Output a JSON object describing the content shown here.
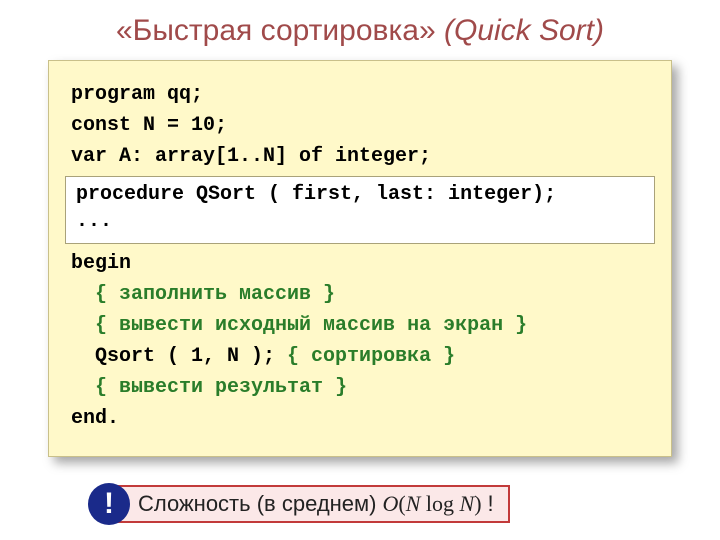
{
  "title": {
    "main": "«Быстрая сортировка»",
    "alt": " (Quick Sort)"
  },
  "code": {
    "l1": "program qq;",
    "l2": "const N = 10;",
    "l3": "var A: array[1..N] of integer;",
    "inset1": "procedure QSort ( first, last: integer);",
    "inset2": "...",
    "l4": "begin",
    "l5a": "  { ",
    "l5b": "заполнить массив",
    "l5c": " }",
    "l6a": "  { ",
    "l6b": "вывести исходный массив на экран",
    "l6c": " }",
    "l7a": "  Qsort ( 1, N );",
    "l7b": " { сортировка }",
    "l8a": "  { ",
    "l8b": "вывести результат",
    "l8c": " }",
    "l9": "end."
  },
  "callout": {
    "bang": "!",
    "prefix": "Сложность (в среднем) ",
    "formula_O": "O",
    "formula_open": "(",
    "formula_N1": "N",
    "formula_log": " log ",
    "formula_N2": "N",
    "formula_close": ")",
    "suffix": " !"
  }
}
